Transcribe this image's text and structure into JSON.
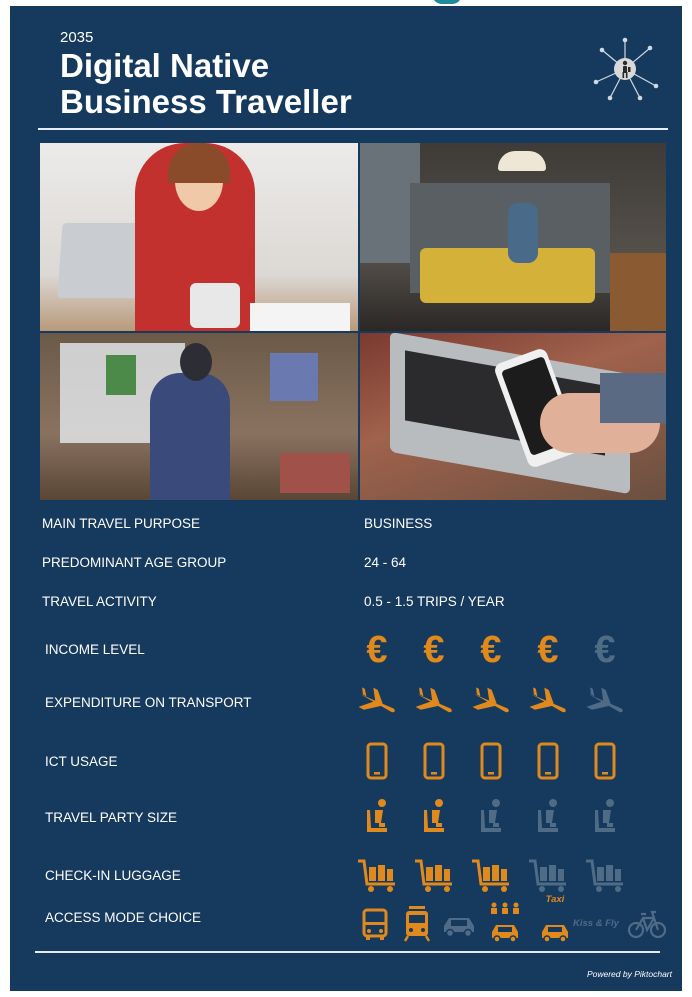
{
  "header": {
    "year": "2035",
    "title_line1": "Digital Native",
    "title_line2": "Business Traveller"
  },
  "colors": {
    "background": "#16395e",
    "active": "#e08a1e",
    "inactive": "#4f6b86",
    "text": "#ffffff"
  },
  "attributes": [
    {
      "label": "MAIN TRAVEL PURPOSE",
      "value": "BUSINESS"
    },
    {
      "label": "PREDOMINANT AGE GROUP",
      "value": "24 - 64"
    },
    {
      "label": "TRAVEL ACTIVITY",
      "value": "0.5 - 1.5 TRIPS / YEAR"
    }
  ],
  "ratings": [
    {
      "label": "INCOME LEVEL",
      "icon": "euro-icon",
      "filled": 4,
      "total": 5
    },
    {
      "label": "EXPENDITURE ON TRANSPORT",
      "icon": "airplane-icon",
      "filled": 4,
      "total": 5
    },
    {
      "label": "ICT USAGE",
      "icon": "smartphone-icon",
      "filled": 5,
      "total": 5
    },
    {
      "label": "TRAVEL PARTY SIZE",
      "icon": "seated-person-icon",
      "filled": 2,
      "total": 5
    },
    {
      "label": "CHECK-IN LUGGAGE",
      "icon": "luggage-cart-icon",
      "filled": 3,
      "total": 5
    }
  ],
  "access_mode": {
    "label": "ACCESS MODE CHOICE",
    "modes": [
      {
        "icon": "bus-icon",
        "active": true
      },
      {
        "icon": "tram-icon",
        "active": true
      },
      {
        "icon": "car-icon",
        "active": false
      },
      {
        "icon": "shared-taxi-icon",
        "active": true
      },
      {
        "icon": "taxi-icon",
        "active": true,
        "text": "Taxi"
      },
      {
        "icon": "kiss-and-fly-icon",
        "active": false,
        "text": "Kiss & Fly"
      },
      {
        "icon": "bicycle-icon",
        "active": false
      }
    ]
  },
  "footer": {
    "powered_by": "Powered by Piktochart"
  }
}
